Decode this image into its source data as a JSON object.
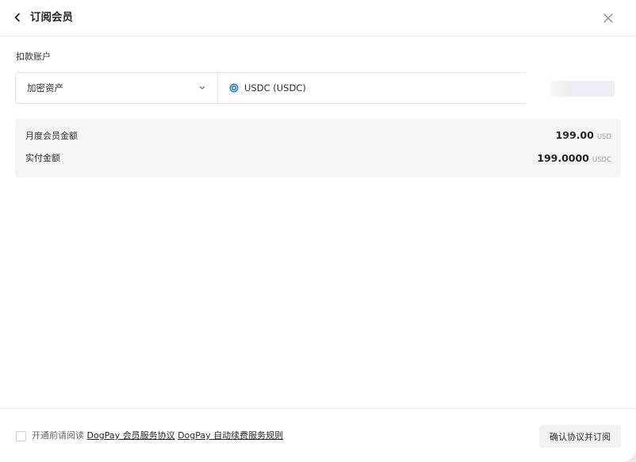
{
  "header": {
    "title": "订阅会员",
    "back_icon": "chevron-left-icon",
    "close_icon": "close-icon"
  },
  "payment_account": {
    "label": "扣款账户",
    "asset_type": "加密资产",
    "currency": "USDC (USDC)",
    "currency_icon": "usdc-coin-icon"
  },
  "summary": {
    "monthly_label": "月度会员金额",
    "monthly_amount": "199.00",
    "monthly_unit": "USD",
    "actual_label": "实付金额",
    "actual_amount": "199.0000",
    "actual_unit": "USDC"
  },
  "footer": {
    "agree_prefix": "开通前请阅读",
    "agreement_1": "DogPay 会员服务协议",
    "agreement_2": "DogPay 自动续费服务规则",
    "confirm_label": "确认协议并订阅"
  },
  "colors": {
    "background": "#ffffff",
    "summary_bg": "#f4f5f7",
    "usdc_blue": "#2775ca"
  }
}
